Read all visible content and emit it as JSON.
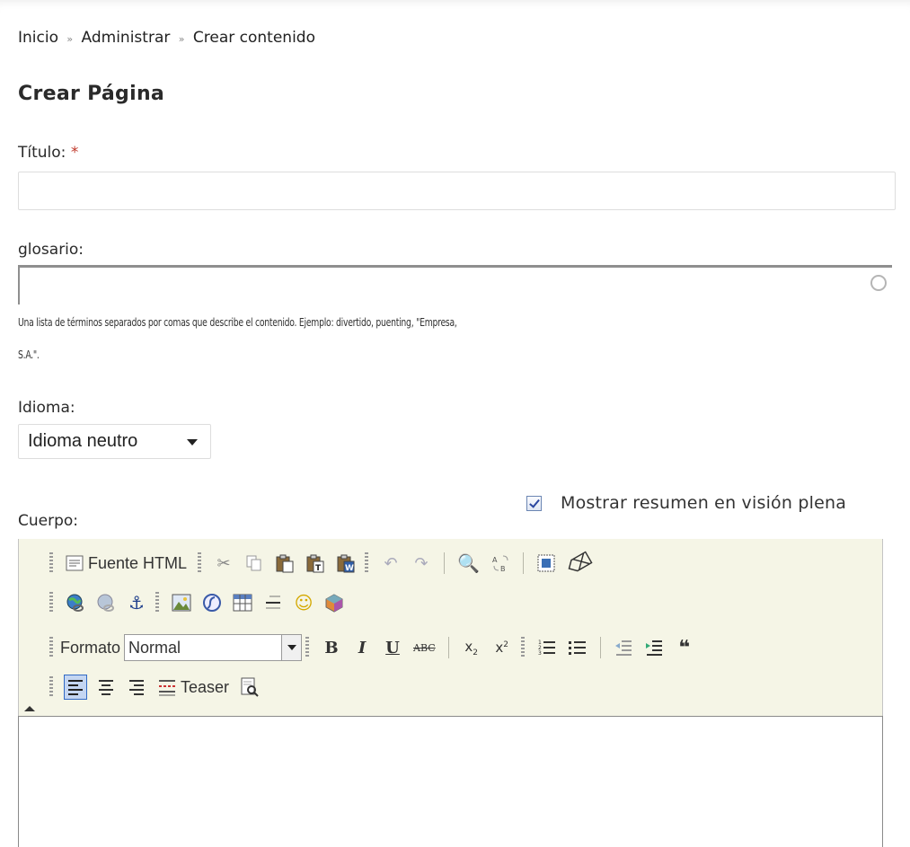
{
  "breadcrumb": {
    "items": [
      "Inicio",
      "Administrar",
      "Crear contenido"
    ],
    "separator": "»"
  },
  "page_title": "Crear Página",
  "form": {
    "title_label": "Título:",
    "title_required": "*",
    "title_value": "",
    "tags_label": "glosario:",
    "tags_value": "",
    "tags_description_line1": "Una lista de términos separados por comas que describe el contenido. Ejemplo: divertido, puenting, \"Empresa,",
    "tags_description_line2": "S.A.\".",
    "language_label": "Idioma:",
    "language_selected": "Idioma neutro",
    "summary_checkbox_label": "Mostrar resumen en visión plena",
    "summary_checked": true,
    "body_label": "Cuerpo:"
  },
  "editor": {
    "source_label": "Fuente HTML",
    "format_label": "Formato",
    "format_selected": "Normal",
    "teaser_label": "Teaser",
    "strike_label": "ABC",
    "bold_glyph": "B",
    "italic_glyph": "I",
    "underline_glyph": "U",
    "blockquote_glyph": "❝",
    "icons_row1": [
      "source-icon",
      "cut-icon",
      "copy-icon",
      "paste-icon",
      "paste-text-icon",
      "paste-word-icon",
      "undo-icon",
      "redo-icon",
      "find-icon",
      "replace-icon",
      "select-all-icon",
      "remove-format-icon"
    ],
    "icons_row2": [
      "link-icon",
      "unlink-icon",
      "anchor-icon",
      "image-icon",
      "flash-icon",
      "table-icon",
      "horizontal-rule-icon",
      "smiley-icon",
      "special-char-icon"
    ],
    "icons_row3": [
      "bold-icon",
      "italic-icon",
      "underline-icon",
      "strikethrough-icon",
      "subscript-icon",
      "superscript-icon",
      "ordered-list-icon",
      "unordered-list-icon",
      "outdent-icon",
      "indent-icon",
      "blockquote-icon"
    ],
    "icons_row4": [
      "align-left-icon",
      "align-center-icon",
      "align-right-icon",
      "teaser-break-icon",
      "preview-icon"
    ],
    "active_alignment": "left",
    "body_value": ""
  }
}
